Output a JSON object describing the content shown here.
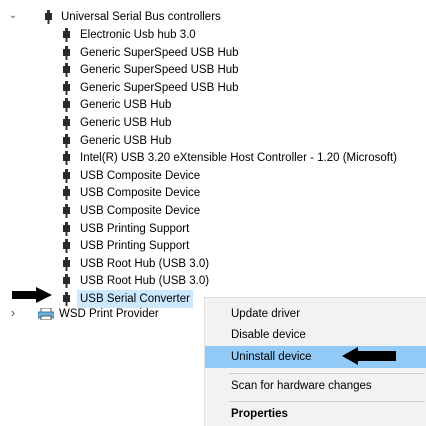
{
  "tree": {
    "root": {
      "label": "Universal Serial Bus controllers",
      "expander": "⌄"
    },
    "children": [
      "Electronic Usb hub 3.0",
      "Generic SuperSpeed USB Hub",
      "Generic SuperSpeed USB Hub",
      "Generic SuperSpeed USB Hub",
      "Generic USB Hub",
      "Generic USB Hub",
      "Generic USB Hub",
      "Intel(R) USB 3.20 eXtensible Host Controller - 1.20 (Microsoft)",
      "USB Composite Device",
      "USB Composite Device",
      "USB Composite Device",
      "USB Printing Support",
      "USB Printing Support",
      "USB Root Hub (USB 3.0)",
      "USB Root Hub (USB 3.0)",
      "USB Serial Converter"
    ],
    "selected_index": 15,
    "sibling": {
      "label": "WSD Print Provider",
      "expander": "›"
    }
  },
  "context_menu": {
    "items": [
      {
        "label": "Update driver"
      },
      {
        "label": "Disable device"
      },
      {
        "label": "Uninstall device"
      },
      {
        "label": "Scan for hardware changes"
      },
      {
        "label": "Properties"
      }
    ],
    "highlighted_index": 2
  },
  "colors": {
    "selection": "#cce8ff",
    "menu_hover": "#91c9f7",
    "menu_bg": "#f2f2f2",
    "arrow": "#000000"
  },
  "icons": {
    "device": "usb-plug-icon",
    "printer": "printer-icon",
    "annotation": "black-arrow-icon"
  }
}
